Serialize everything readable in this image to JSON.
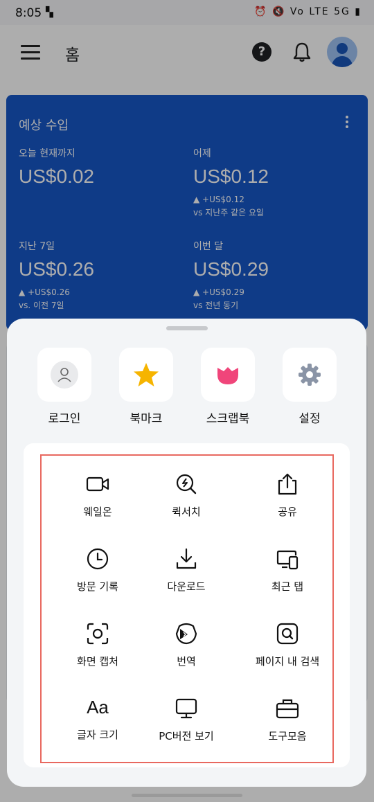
{
  "status": {
    "time": "8:05",
    "right": "⏰ 🔇 Vo LTE 5G ▮"
  },
  "appbar": {
    "title": "홈"
  },
  "earnings": {
    "title": "예상 수입",
    "today": {
      "label": "오늘 현재까지",
      "value": "US$0.02"
    },
    "yesterday": {
      "label": "어제",
      "value": "US$0.12",
      "delta": "▲ +US$0.12",
      "compare": "vs 지난주 같은 요일"
    },
    "last7": {
      "label": "지난 7일",
      "value": "US$0.26",
      "delta": "▲ +US$0.26",
      "compare": "vs. 이전 7일"
    },
    "month": {
      "label": "이번 달",
      "value": "US$0.29",
      "delta": "▲ +US$0.29",
      "compare": "vs 전년 동기"
    }
  },
  "sheet": {
    "quick": [
      {
        "label": "로그인",
        "icon": "user-icon"
      },
      {
        "label": "북마크",
        "icon": "star-icon"
      },
      {
        "label": "스크랩북",
        "icon": "tulip-icon"
      },
      {
        "label": "설정",
        "icon": "gear-icon"
      }
    ],
    "grid": [
      {
        "label": "웨일온",
        "icon": "video-camera-icon"
      },
      {
        "label": "퀵서치",
        "icon": "quick-search-icon"
      },
      {
        "label": "공유",
        "icon": "share-icon"
      },
      {
        "label": "방문 기록",
        "icon": "clock-icon"
      },
      {
        "label": "다운로드",
        "icon": "download-icon"
      },
      {
        "label": "최근 탭",
        "icon": "devices-icon"
      },
      {
        "label": "화면 캡처",
        "icon": "capture-icon"
      },
      {
        "label": "번역",
        "icon": "translate-icon"
      },
      {
        "label": "페이지 내 검색",
        "icon": "find-in-page-icon"
      },
      {
        "label": "글자 크기",
        "icon": "font-size-icon",
        "glyph": "Aa"
      },
      {
        "label": "PC버전 보기",
        "icon": "monitor-icon"
      },
      {
        "label": "도구모음",
        "icon": "toolbox-icon"
      }
    ]
  },
  "colors": {
    "card": "#1757c8",
    "highlight": "#e8685f",
    "star": "#f6b400",
    "tulip": "#f0457a",
    "gear": "#8a94a6"
  }
}
